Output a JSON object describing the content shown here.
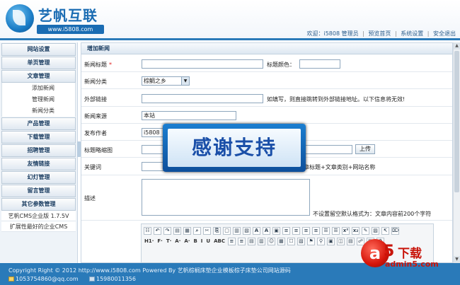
{
  "header": {
    "logo_text": "艺帆互联",
    "logo_url": "www.i5808.com",
    "nav": {
      "welcome": "欢迎：",
      "user": "i5808 管理员",
      "preview": "预览首页",
      "settings": "系统设置",
      "logout": "安全退出"
    }
  },
  "sidebar": {
    "groups": [
      {
        "label": "网站设置"
      },
      {
        "label": "单页管理"
      },
      {
        "label": "文章管理",
        "children": [
          "添加新闻",
          "管理新闻",
          "新闻分类"
        ]
      },
      {
        "label": "产品管理"
      },
      {
        "label": "下载管理"
      },
      {
        "label": "招聘管理"
      },
      {
        "label": "友情链接"
      },
      {
        "label": "幻灯管理"
      },
      {
        "label": "留言管理"
      },
      {
        "label": "其它参数管理"
      }
    ],
    "info": [
      "艺帆CMS企业版 1.7.5V",
      "扩展性最好的企业CMS"
    ]
  },
  "main": {
    "title": "增加新闻",
    "form": {
      "news_title_label": "新闻标题",
      "required_mark": "*",
      "title_color_label": "标题颜色：",
      "category_label": "新闻分类",
      "category_value": "棕鲷之乡",
      "external_link_label": "外部链接",
      "external_link_hint": "如填写，则直接跳转到外部链接地址。以下信息将无效!",
      "source_label": "新闻来源",
      "source_value": "本站",
      "author_label": "发布作者",
      "author_value": "i5808",
      "thumb_label": "标题略缩图",
      "upload_label": "上传",
      "keywords_label": "关键词",
      "keywords_hint": "章标题+文章类别+网站名称",
      "desc_label": "描述",
      "desc_hint": "不设置留空默认格式为：文章内容前200个字符"
    },
    "editor": {
      "row1": [
        "☷",
        "↶",
        "↷",
        "▤",
        "▦",
        "⌕",
        "✂",
        "⎘",
        "▢",
        "▥",
        "▧",
        "A",
        "A",
        "▣",
        "≡",
        "≡",
        "≡",
        "≡",
        "☰",
        "☰",
        "x²",
        "x₂",
        "✎",
        "▨",
        "↸",
        "⌦"
      ],
      "row2_text": [
        "H1·",
        "F·",
        "T·",
        "A·",
        "A·",
        "B",
        "I",
        "U",
        "ABC"
      ],
      "row2_icons": [
        "≡",
        "≡",
        "▤",
        "▥",
        "☺",
        "▦",
        "☐",
        "▧",
        "⚑",
        "⚲",
        "▣",
        "◫",
        "▤",
        "☍",
        "▦",
        "⚙"
      ]
    }
  },
  "overlay": {
    "text": "感谢支持"
  },
  "footer": {
    "copyright": "Copyright Right © 2012 http://www.i5808.com Powered By 艺帆棕榈床垫企业模板棕子床垫公司网站源码",
    "email": "1053754860@qq.com",
    "phone": "15980011356"
  },
  "watermark": {
    "letter": "a",
    "digit": "5",
    "title": "下载",
    "url": "admin5.com"
  },
  "colors": {
    "brand_blue": "#2a7ab9",
    "required_red": "#e02020",
    "watermark_red": "#c8140a"
  }
}
